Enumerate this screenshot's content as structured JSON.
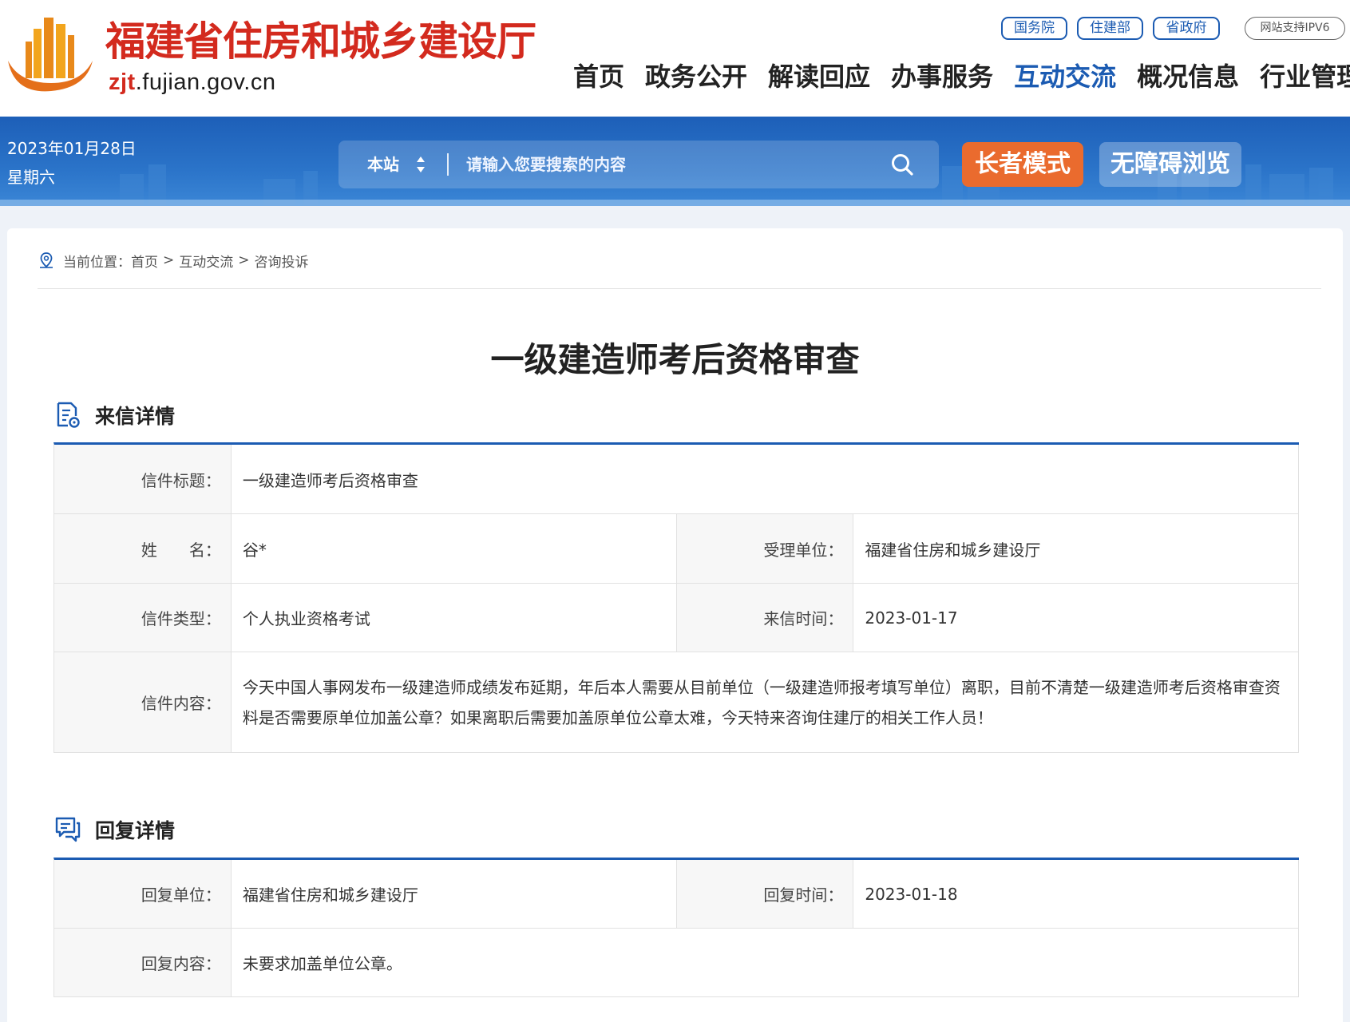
{
  "header": {
    "site_name": "福建省住房和城乡建设厅",
    "domain_bold": "zjt",
    "domain_rest": ".fujian.gov.cn",
    "gov_links": [
      "国务院",
      "住建部",
      "省政府"
    ],
    "ipv6_label": "网站支持IPV6",
    "nav": [
      "首页",
      "政务公开",
      "解读回应",
      "办事服务",
      "互动交流",
      "概况信息",
      "行业管理"
    ],
    "nav_active": "互动交流"
  },
  "band": {
    "date": "2023年01月28日",
    "weekday": "星期六",
    "search_scope": "本站",
    "search_placeholder": "请输入您要搜索的内容",
    "elder_mode_label": "长者模式",
    "accessible_label": "无障碍浏览"
  },
  "breadcrumb": {
    "prefix": "当前位置：",
    "items": [
      "首页",
      "互动交流",
      "咨询投诉"
    ],
    "separator": ">"
  },
  "letter": {
    "title": "一级建造师考后资格审查",
    "section_title": "来信详情",
    "labels": {
      "subject": "信件标题：",
      "name": "姓　　名：",
      "dept": "受理单位：",
      "type": "信件类型：",
      "date": "来信时间：",
      "content": "信件内容："
    },
    "subject": "一级建造师考后资格审查",
    "name": "谷*",
    "dept": "福建省住房和城乡建设厅",
    "type": "个人执业资格考试",
    "date": "2023-01-17",
    "content": "今天中国人事网发布一级建造师成绩发布延期，年后本人需要从目前单位（一级建造师报考填写单位）离职，目前不清楚一级建造师考后资格审查资料是否需要原单位加盖公章？如果离职后需要加盖原单位公章太难，今天特来咨询住建厅的相关工作人员！"
  },
  "reply": {
    "section_title": "回复详情",
    "labels": {
      "dept": "回复单位：",
      "date": "回复时间：",
      "content": "回复内容："
    },
    "dept": "福建省住房和城乡建设厅",
    "date": "2023-01-18",
    "content": "未要求加盖单位公章。"
  },
  "colors": {
    "brand_red": "#d32a1e",
    "brand_blue": "#1b5bb2",
    "elder_orange": "#ea6b2e"
  },
  "icons": [
    "logo-mark",
    "sort-arrows-icon",
    "search-icon",
    "location-pin-icon",
    "letter-doc-icon",
    "reply-chat-icon"
  ]
}
